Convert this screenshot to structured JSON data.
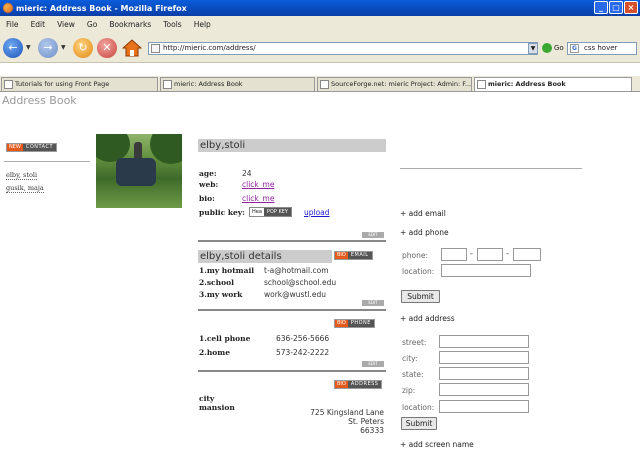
{
  "window": {
    "title": "mieric: Address Book - Mozilla Firefox",
    "controls": {
      "minimize": "_",
      "maximize": "□",
      "close": "×"
    }
  },
  "menu": [
    "File",
    "Edit",
    "View",
    "Go",
    "Bookmarks",
    "Tools",
    "Help"
  ],
  "nav": {
    "url": "http://mieric.com/address/",
    "go_label": "Go",
    "search_value": "css hover"
  },
  "tabs": [
    {
      "label": "Tutorials for using Front Page",
      "active": false
    },
    {
      "label": "mieric: Address Book",
      "active": false
    },
    {
      "label": "SourceForge.net: mieric Project: Admin: F...",
      "active": false
    },
    {
      "label": "mieric: Address Book",
      "active": true
    }
  ],
  "page": {
    "title": "Address Book",
    "new_contact_badge": {
      "a": "NEW",
      "b": "CONTACT"
    },
    "contacts": [
      "elby, stoli",
      "gusik, maja"
    ]
  },
  "contact": {
    "name": "elby,stoli",
    "age_label": "age:",
    "age_value": "24",
    "web_label": "web:",
    "web_value": "click_me",
    "bio_label": "bio:",
    "bio_value": "click_me",
    "pk_label": "public key:",
    "pk_badge": {
      "a": "Hea",
      "b": "POP KEY"
    },
    "upload_label": "upload",
    "edit_label": "EDIT"
  },
  "details": {
    "title": "elby,stoli details",
    "email_badge": {
      "a": "BIO",
      "b": "EMAIL"
    },
    "emails": [
      {
        "label": "1.my hotmail",
        "value": "t-a@hotmail.com"
      },
      {
        "label": "2.school",
        "value": "school@school.edu"
      },
      {
        "label": "3.my work",
        "value": "work@wustl.edu"
      }
    ],
    "phone_badge": {
      "a": "BIO",
      "b": "PHONE"
    },
    "phones": [
      {
        "label": "1.cell phone",
        "value": "636-256-5666"
      },
      {
        "label": "2.home",
        "value": "573-242-2222"
      }
    ],
    "address_badge": {
      "a": "BIO",
      "b": "ADDRESS"
    },
    "address_label_1": "city",
    "address_label_2": "mansion",
    "address_lines": [
      "725 Kingsland Lane",
      "St. Peters",
      "66333"
    ]
  },
  "forms": {
    "add_email": "+ add email",
    "add_phone": "+ add phone",
    "phone_label": "phone:",
    "location_label": "location:",
    "submit": "Submit",
    "add_address": "+ add address",
    "street_label": "street:",
    "city_label": "city:",
    "state_label": "state:",
    "zip_label": "zip:",
    "add_screen_name": "+ add screen name",
    "dash": "-"
  }
}
